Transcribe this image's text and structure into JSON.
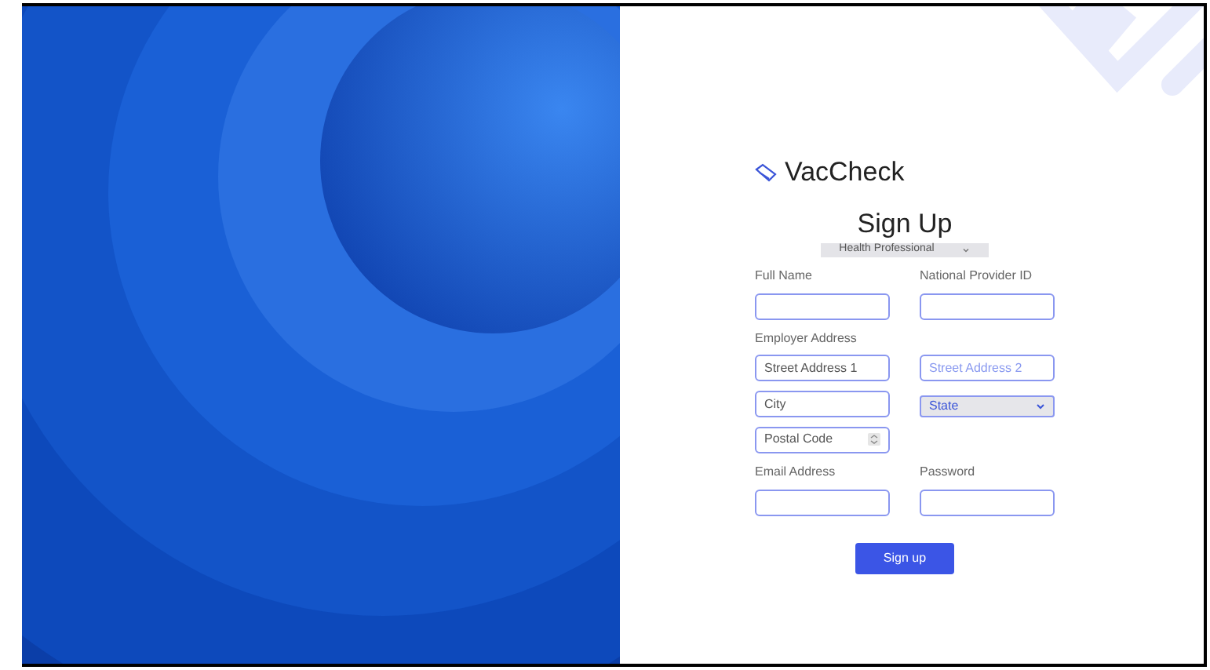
{
  "brand": {
    "name": "VacCheck"
  },
  "title": "Sign Up",
  "role_select": {
    "value": "Health Professional"
  },
  "rows": [
    {
      "kind": "pair",
      "fields": [
        {
          "label": "Full Name"
        },
        {
          "label": "National Provider ID"
        }
      ]
    },
    {
      "kind": "section",
      "label": "Employer Address"
    },
    {
      "kind": "pair",
      "fields": [
        {
          "placeholder": "Street Address 1"
        },
        {
          "placeholder": "Street Address 2",
          "highlight": true
        }
      ]
    },
    {
      "kind": "pair",
      "fields": [
        {
          "placeholder": "City"
        },
        {
          "placeholder": "State",
          "kind": "select"
        }
      ]
    },
    {
      "kind": "pair",
      "fields": [
        {
          "placeholder": "Postal Code",
          "kind": "number"
        }
      ]
    },
    {
      "kind": "pair",
      "fields": [
        {
          "label": "Email Address"
        },
        {
          "label": "Password",
          "kind": "password"
        }
      ]
    }
  ],
  "submit": "Sign up"
}
